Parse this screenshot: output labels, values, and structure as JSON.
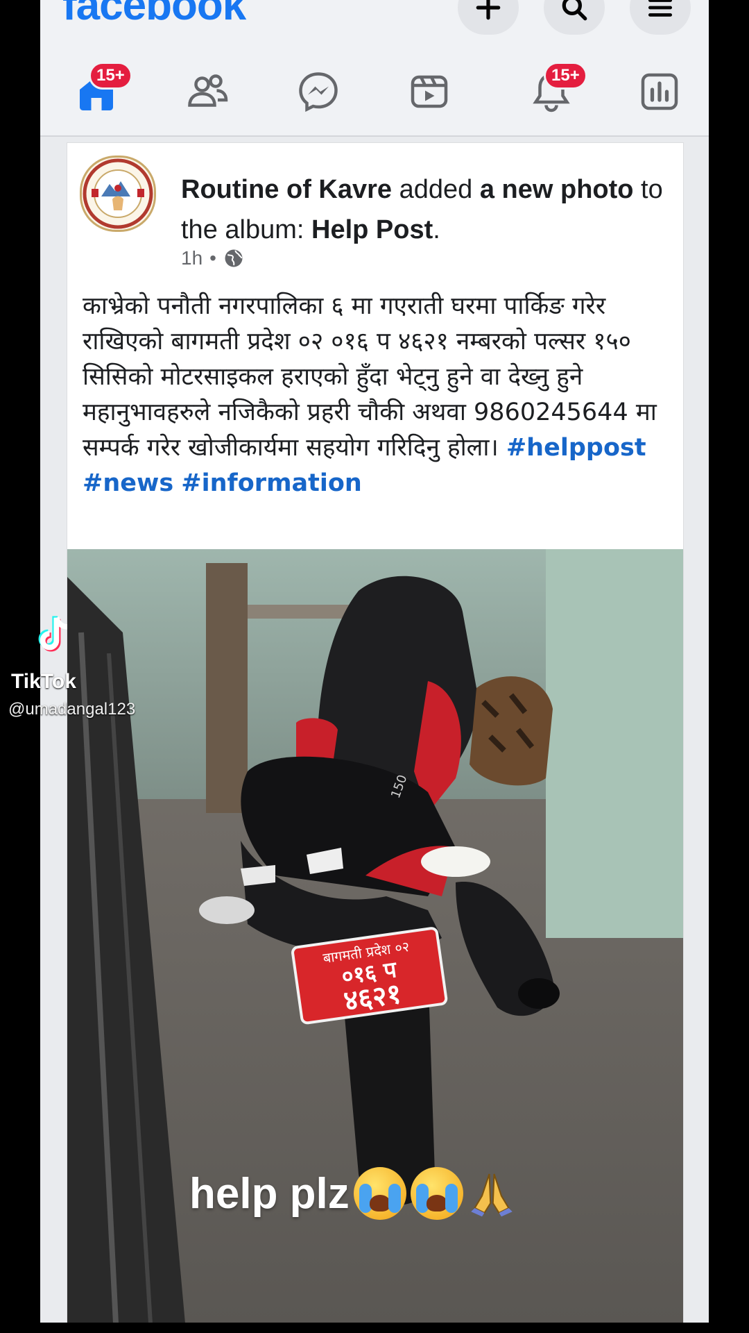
{
  "app": {
    "logo": "facebook",
    "top_buttons": [
      "plus-icon",
      "search-icon",
      "menu-icon"
    ]
  },
  "nav": {
    "items": [
      {
        "name": "home",
        "icon": "home-icon",
        "badge": "15+"
      },
      {
        "name": "friends",
        "icon": "friends-icon",
        "badge": ""
      },
      {
        "name": "messenger",
        "icon": "messenger-icon",
        "badge": ""
      },
      {
        "name": "video",
        "icon": "video-icon",
        "badge": ""
      },
      {
        "name": "notifications",
        "icon": "bell-icon",
        "badge": "15+"
      },
      {
        "name": "dashboard",
        "icon": "chart-icon",
        "badge": ""
      }
    ]
  },
  "post": {
    "page_name": "Routine of Kavre",
    "action_1": " added ",
    "action_bold": "a new photo",
    "action_2": " to the album: ",
    "album": "Help Post",
    "album_suffix": ".",
    "time": "1h",
    "separator": "•",
    "privacy_icon": "globe-icon",
    "body": "काभ्रेको पनौती नगरपालिका ६ मा गएराती घरमा पार्किङ गरेर राखिएको बागमती प्रदेश ०२ ०१६ प ४६२१ नम्बरको पल्सर १५० सिसिको मोटरसाइकल हराएको हुँदा भेट्नु हुने वा देख्नु हुने महानुभावहरुले नजिकैको प्रहरी चौकी अथवा 9860245644 मा सम्पर्क गरेर खोजीकार्यमा सहयोग गरिदिनु होला।",
    "hashtags": [
      "#helppost",
      "#news",
      "#information"
    ],
    "photo_caption": "help plz",
    "plate": {
      "line1": "बागमती प्रदेश ०२",
      "line2": "०१६ प",
      "line3": "४६२१"
    },
    "tank_label": "150"
  },
  "watermark": {
    "brand": "TikTok",
    "user": "@umadangal123"
  },
  "colors": {
    "brand": "#1877f2",
    "badge": "#e41e3f",
    "hashtag": "#1766c9",
    "plate": "#d8262a"
  }
}
